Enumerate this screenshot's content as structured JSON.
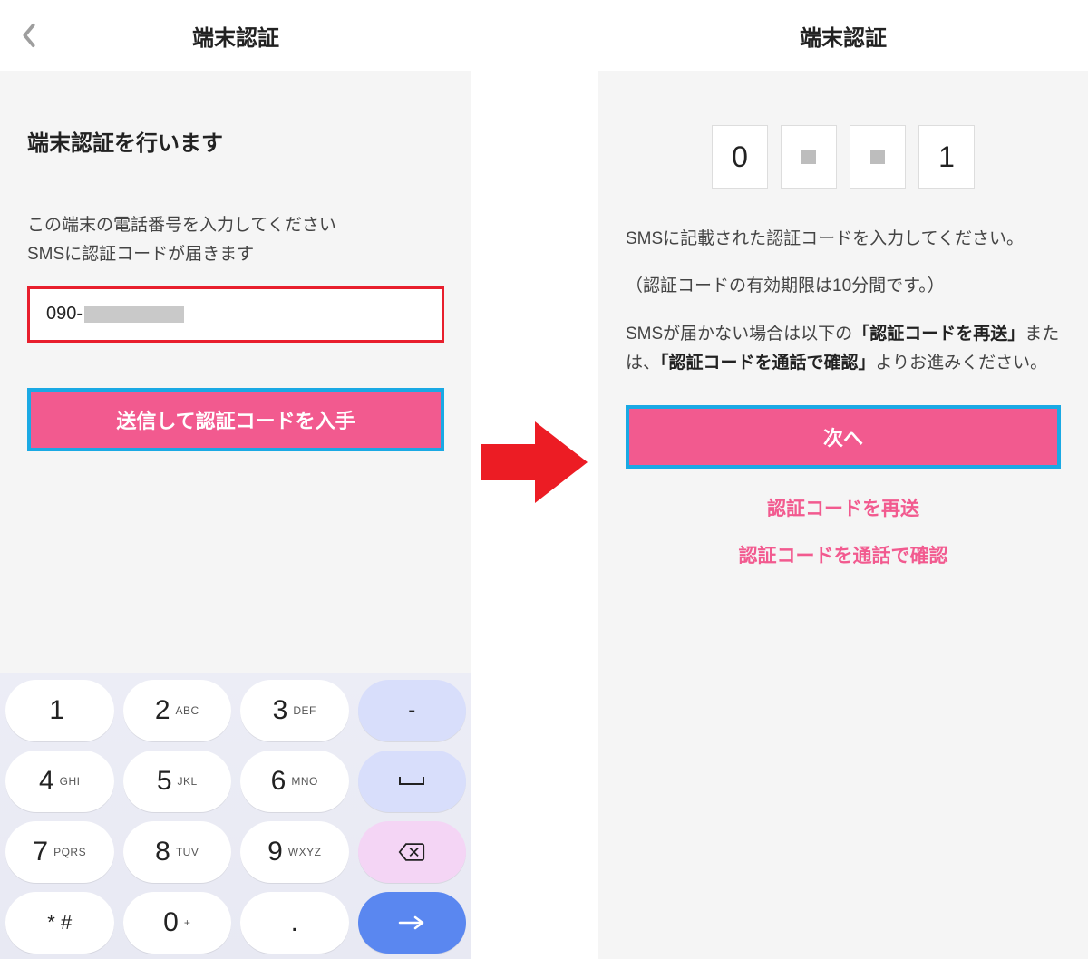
{
  "left": {
    "header": {
      "title": "端末認証"
    },
    "heading": "端末認証を行います",
    "instruction_line1": "この端末の電話番号を入力してください",
    "instruction_line2": "SMSに認証コードが届きます",
    "phone_prefix": "090-",
    "submit_label": "送信して認証コードを入手"
  },
  "right": {
    "header": {
      "title": "端末認証"
    },
    "code_digits": [
      "0",
      "",
      "",
      "1"
    ],
    "instruction_line1": "SMSに記載された認証コードを入力してください。",
    "instruction_line2": "（認証コードの有効期限は10分間です。）",
    "help_pre": "SMSが届かない場合は以下の",
    "help_bold1": "「認証コードを再送」",
    "help_mid": "または、",
    "help_bold2": "「認証コードを通話で確認」",
    "help_post": "よりお進みください。",
    "next_label": "次へ",
    "resend_link": "認証コードを再送",
    "call_link": "認証コードを通話で確認"
  },
  "keypad": {
    "rows": [
      [
        {
          "n": "1",
          "s": ""
        },
        {
          "n": "2",
          "s": "ABC"
        },
        {
          "n": "3",
          "s": "DEF"
        },
        {
          "n": "-",
          "fn": true
        }
      ],
      [
        {
          "n": "4",
          "s": "GHI"
        },
        {
          "n": "5",
          "s": "JKL"
        },
        {
          "n": "6",
          "s": "MNO"
        },
        {
          "n": "␣",
          "fn": true,
          "space": true
        }
      ],
      [
        {
          "n": "7",
          "s": "PQRS"
        },
        {
          "n": "8",
          "s": "TUV"
        },
        {
          "n": "9",
          "s": "WXYZ"
        },
        {
          "n": "⌫",
          "del": true
        }
      ],
      [
        {
          "n": "* #",
          "s": ""
        },
        {
          "n": "0",
          "s": "+"
        },
        {
          "n": ".",
          "s": ""
        },
        {
          "n": "→",
          "enter": true
        }
      ]
    ]
  }
}
